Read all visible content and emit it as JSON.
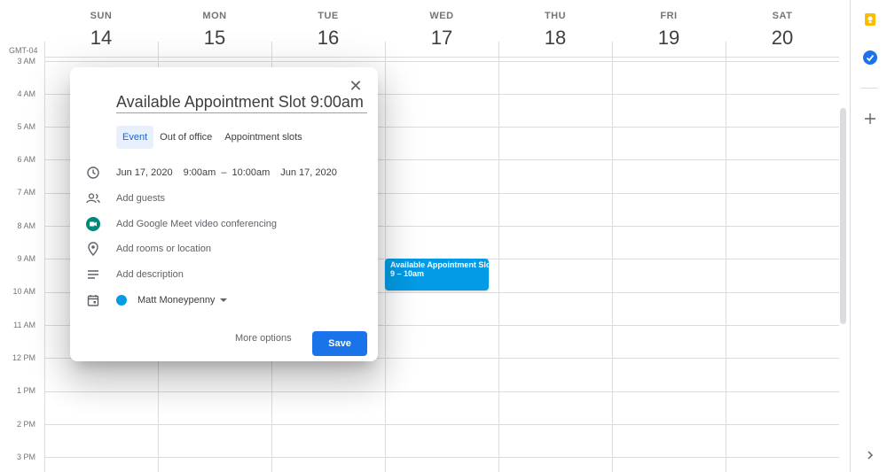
{
  "calendar": {
    "timezone": "GMT-04",
    "days": [
      {
        "name": "SUN",
        "num": "14"
      },
      {
        "name": "MON",
        "num": "15"
      },
      {
        "name": "TUE",
        "num": "16"
      },
      {
        "name": "WED",
        "num": "17"
      },
      {
        "name": "THU",
        "num": "18"
      },
      {
        "name": "FRI",
        "num": "19"
      },
      {
        "name": "SAT",
        "num": "20"
      }
    ],
    "hours": [
      "3 AM",
      "4 AM",
      "5 AM",
      "6 AM",
      "7 AM",
      "8 AM",
      "9 AM",
      "10 AM",
      "11 AM",
      "12 PM",
      "1 PM",
      "2 PM",
      "3 PM"
    ]
  },
  "event_chip": {
    "title": "Available Appointment Slot",
    "time": "9 – 10am",
    "color": "#039be5"
  },
  "dialog": {
    "title_value": "Available Appointment Slot 9:00am",
    "close_icon": "close-icon",
    "tabs": [
      {
        "label": "Event",
        "active": true
      },
      {
        "label": "Out of office",
        "active": false
      },
      {
        "label": "Appointment slots",
        "active": false
      }
    ],
    "start_date": "Jun 17, 2020",
    "start_time": "9:00am",
    "dash": "–",
    "end_time": "10:00am",
    "end_date": "Jun 17, 2020",
    "guests_placeholder": "Add guests",
    "meet_text": "Add Google Meet video conferencing",
    "location_placeholder": "Add rooms or location",
    "description_placeholder": "Add description",
    "calendar_owner": "Matt Moneypenny",
    "more_options_label": "More options",
    "save_label": "Save",
    "accent": "#1a73e8"
  },
  "side_panel": {
    "icons": [
      "keep-icon",
      "tasks-icon",
      "add-icon",
      "chevron-right-icon"
    ]
  }
}
